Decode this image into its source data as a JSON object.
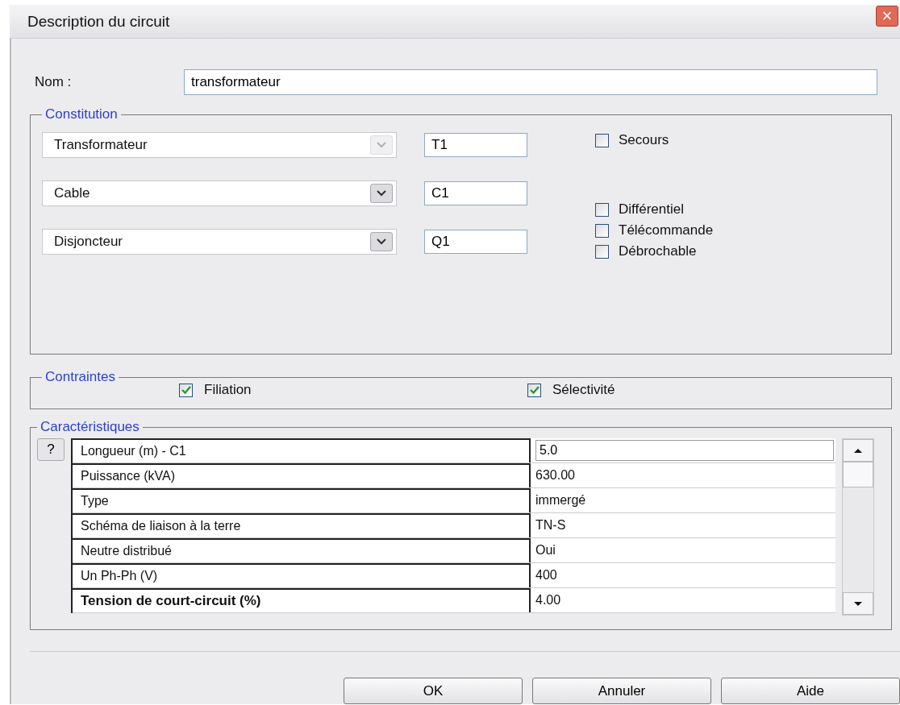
{
  "window": {
    "title": "Description du circuit",
    "close": "×"
  },
  "name_field": {
    "label": "Nom :",
    "value": "transformateur"
  },
  "constitution": {
    "title": "Constitution",
    "components": [
      {
        "type": "Transformateur",
        "code": "T1",
        "disabled": true
      },
      {
        "type": "Cable",
        "code": "C1",
        "disabled": false
      },
      {
        "type": "Disjoncteur",
        "code": "Q1",
        "disabled": false
      }
    ],
    "options": [
      {
        "label": "Secours",
        "checked": false
      },
      {
        "label": "Différentiel",
        "checked": false
      },
      {
        "label": "Télécommande",
        "checked": false
      },
      {
        "label": "Débrochable",
        "checked": false
      }
    ]
  },
  "constraints": {
    "title": "Contraintes",
    "options": [
      {
        "label": "Filiation",
        "checked": true
      },
      {
        "label": "Sélectivité",
        "checked": true
      }
    ]
  },
  "characteristics": {
    "title": "Caractéristiques",
    "help": "?",
    "rows": [
      {
        "name": "Longueur (m) - C1",
        "value": "5.0",
        "editing": true,
        "bold": false
      },
      {
        "name": "Puissance (kVA)",
        "value": "630.00",
        "editing": false,
        "bold": false
      },
      {
        "name": "Type",
        "value": "immergé",
        "editing": false,
        "bold": false
      },
      {
        "name": "Schéma de liaison à la terre",
        "value": "TN-S",
        "editing": false,
        "bold": false
      },
      {
        "name": "Neutre distribué",
        "value": "Oui",
        "editing": false,
        "bold": false
      },
      {
        "name": "Un Ph-Ph (V)",
        "value": "400",
        "editing": false,
        "bold": false
      },
      {
        "name": "Tension de court-circuit (%)",
        "value": "4.00",
        "editing": false,
        "bold": true
      }
    ]
  },
  "buttons": [
    "OK",
    "Annuler",
    "Aide"
  ]
}
